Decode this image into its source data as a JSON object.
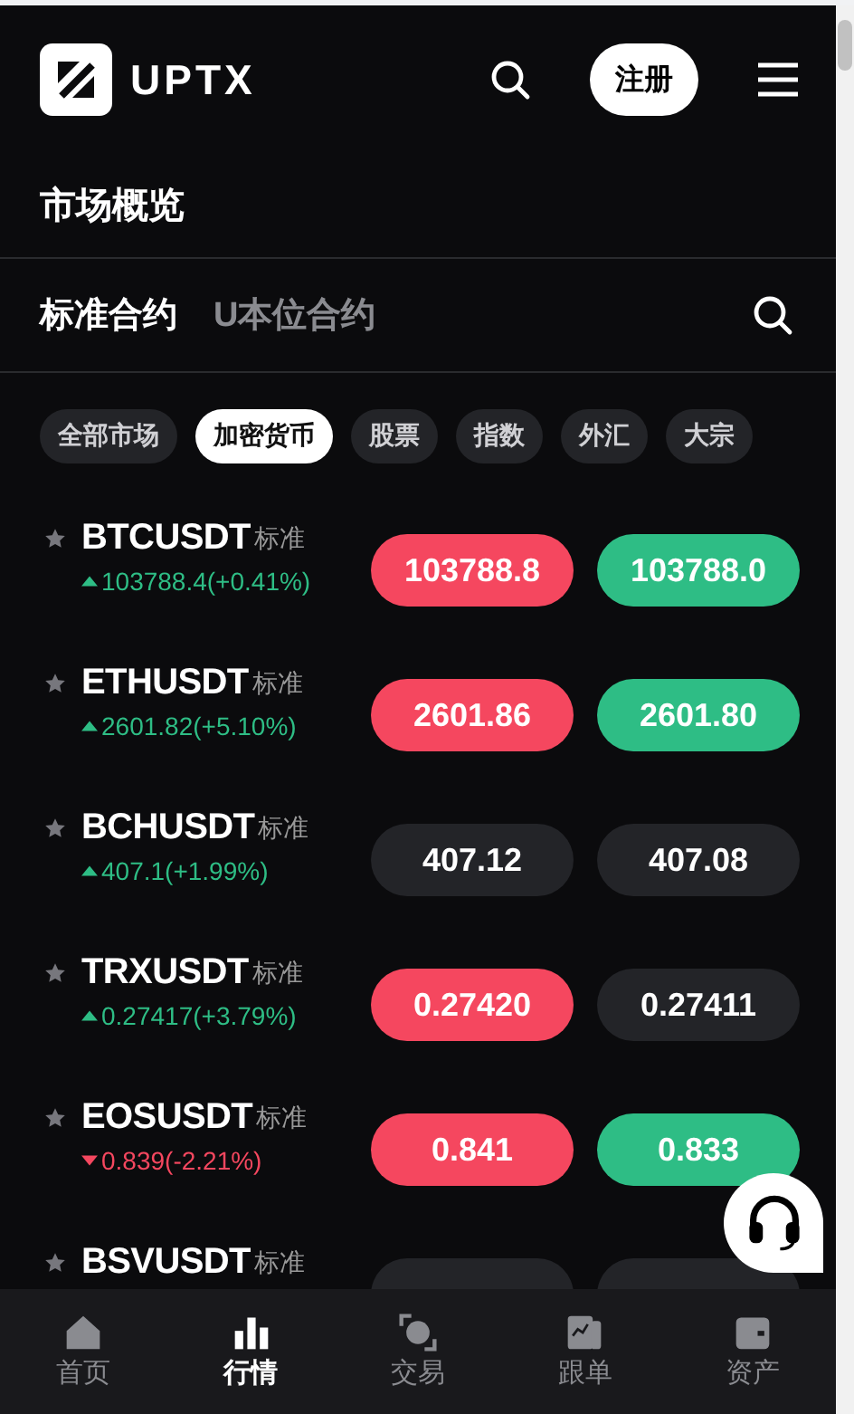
{
  "header": {
    "logo": "UPTX",
    "register": "注册"
  },
  "section_title": "市场概览",
  "tabs": [
    {
      "label": "标准合约",
      "selected": true
    },
    {
      "label": "U本位合约",
      "selected": false
    }
  ],
  "chips": [
    {
      "label": "全部市场",
      "selected": false
    },
    {
      "label": "加密货币",
      "selected": true
    },
    {
      "label": "股票",
      "selected": false
    },
    {
      "label": "指数",
      "selected": false
    },
    {
      "label": "外汇",
      "selected": false
    },
    {
      "label": "大宗",
      "selected": false
    }
  ],
  "rows": [
    {
      "symbol": "BTCUSDT",
      "tag": "标准",
      "change": "103788.4(+0.41%)",
      "rising": true,
      "bid": {
        "price": "103788.8",
        "color": "#f5475f"
      },
      "ask": {
        "price": "103788.0",
        "color": "#2ebd85"
      }
    },
    {
      "symbol": "ETHUSDT",
      "tag": "标准",
      "change": "2601.82(+5.10%)",
      "rising": true,
      "bid": {
        "price": "2601.86",
        "color": "#f5475f"
      },
      "ask": {
        "price": "2601.80",
        "color": "#2ebd85"
      }
    },
    {
      "symbol": "BCHUSDT",
      "tag": "标准",
      "change": "407.1(+1.99%)",
      "rising": true,
      "bid": {
        "price": "407.12",
        "color": "#232428"
      },
      "ask": {
        "price": "407.08",
        "color": "#232428"
      }
    },
    {
      "symbol": "TRXUSDT",
      "tag": "标准",
      "change": "0.27417(+3.79%)",
      "rising": true,
      "bid": {
        "price": "0.27420",
        "color": "#f5475f"
      },
      "ask": {
        "price": "0.27411",
        "color": "#232428"
      }
    },
    {
      "symbol": "EOSUSDT",
      "tag": "标准",
      "change": "0.839(-2.21%)",
      "rising": false,
      "bid": {
        "price": "0.841",
        "color": "#f5475f"
      },
      "ask": {
        "price": "0.833",
        "color": "#2ebd85"
      }
    },
    {
      "symbol": "BSVUSDT",
      "tag": "标准",
      "bid": {
        "color": "#232428"
      },
      "ask": {
        "color": "#232428"
      }
    }
  ],
  "nav": [
    {
      "label": "首页",
      "kind": "home",
      "selected": false
    },
    {
      "label": "行情",
      "kind": "market",
      "selected": true
    },
    {
      "label": "交易",
      "kind": "trade",
      "selected": false
    },
    {
      "label": "跟单",
      "kind": "copy",
      "selected": false
    },
    {
      "label": "资产",
      "kind": "assets",
      "selected": false
    }
  ]
}
